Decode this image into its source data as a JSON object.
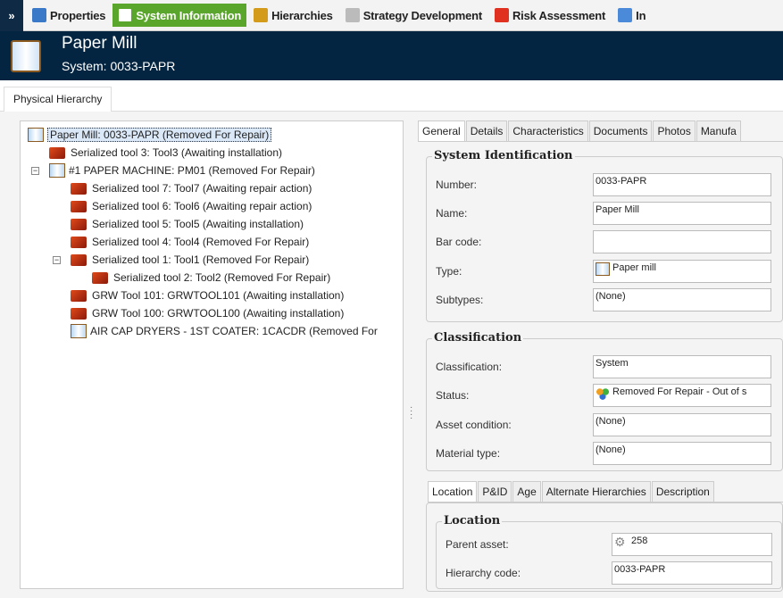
{
  "toolbar": {
    "items": [
      {
        "label": "Properties",
        "color": "#3a78c8"
      },
      {
        "label": "System Information",
        "color": "#5aa52c"
      },
      {
        "label": "Hierarchies",
        "color": "#d49a1a"
      },
      {
        "label": "Strategy Development",
        "color": "#bbbbbb"
      },
      {
        "label": "Risk Assessment",
        "color": "#e03020"
      },
      {
        "label": "In",
        "color": "#4a8ad8"
      }
    ]
  },
  "header": {
    "title": "Paper Mill",
    "subtitle": "System:  0033-PAPR"
  },
  "tab": "Physical Hierarchy",
  "tree": [
    {
      "label": "Paper Mill: 0033-PAPR (Removed For Repair)",
      "icon": "book"
    },
    {
      "label": "Serialized tool 3: Tool3 (Awaiting installation)",
      "icon": "tool"
    },
    {
      "label": "#1 PAPER MACHINE: PM01 (Removed For Repair)",
      "icon": "book"
    },
    {
      "label": "Serialized tool 7: Tool7 (Awaiting repair action)",
      "icon": "tool"
    },
    {
      "label": "Serialized tool 6: Tool6 (Awaiting repair action)",
      "icon": "tool"
    },
    {
      "label": "Serialized tool 5: Tool5 (Awaiting installation)",
      "icon": "tool"
    },
    {
      "label": "Serialized tool 4: Tool4 (Removed For Repair)",
      "icon": "tool"
    },
    {
      "label": "Serialized tool 1: Tool1 (Removed For Repair)",
      "icon": "tool"
    },
    {
      "label": "Serialized tool 2: Tool2 (Removed For Repair)",
      "icon": "tool"
    },
    {
      "label": "GRW Tool 101: GRWTOOL101 (Awaiting installation)",
      "icon": "tool"
    },
    {
      "label": "GRW Tool 100: GRWTOOL100 (Awaiting installation)",
      "icon": "tool"
    },
    {
      "label": "AIR CAP DRYERS - 1ST COATER: 1CACDR (Removed For",
      "icon": "book"
    }
  ],
  "tabs": [
    "General",
    "Details",
    "Characteristics",
    "Documents",
    "Photos",
    "Manufa"
  ],
  "ident": {
    "title": "System Identification",
    "fields": [
      {
        "label": "Number:",
        "value": "0033-PAPR"
      },
      {
        "label": "Name:",
        "value": "Paper Mill"
      },
      {
        "label": "Bar code:",
        "value": ""
      },
      {
        "label": "Type:",
        "value": "Paper mill"
      },
      {
        "label": "Subtypes:",
        "value": "(None)"
      }
    ]
  },
  "classif": {
    "title": "Classification",
    "fields": [
      {
        "label": "Classification:",
        "value": "System"
      },
      {
        "label": "Status:",
        "value": "Removed For Repair - Out of s"
      },
      {
        "label": "Asset condition:",
        "value": "(None)"
      },
      {
        "label": "Material type:",
        "value": "(None)"
      }
    ]
  },
  "subtabs": [
    "Location",
    "P&ID",
    "Age",
    "Alternate Hierarchies",
    "Description"
  ],
  "location": {
    "title": "Location",
    "fields": [
      {
        "label": "Parent asset:",
        "value": "258"
      },
      {
        "label": "Hierarchy code:",
        "value": "0033-PAPR"
      }
    ]
  }
}
